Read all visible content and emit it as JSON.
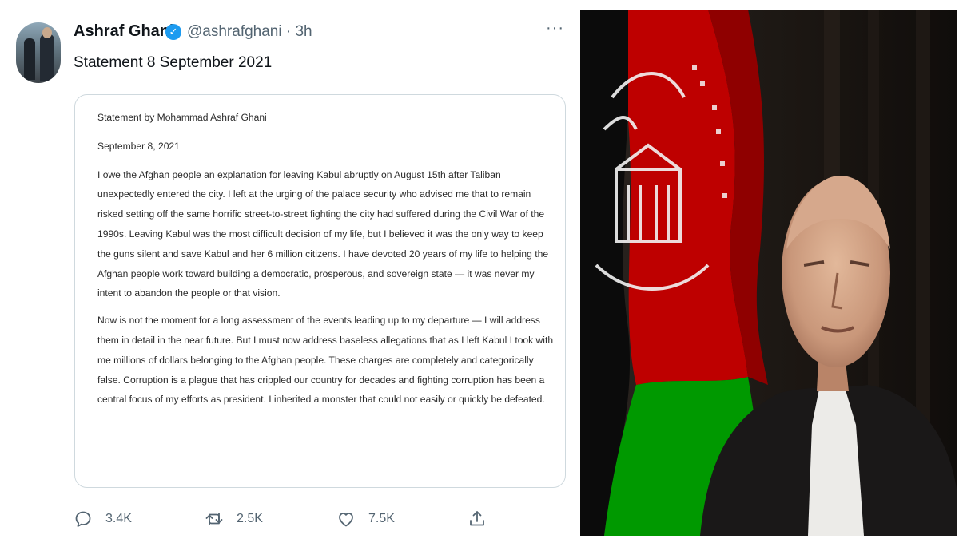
{
  "tweet": {
    "author_name": "Ashraf Ghani",
    "handle_time": "@ashrafghani · 3h",
    "more": "···",
    "text": "Statement 8 September 2021",
    "document": {
      "title": "Statement by Mohammad Ashraf Ghani",
      "date": "September 8, 2021",
      "paragraph_1": "I owe the Afghan people an explanation for leaving Kabul abruptly on August 15th after Taliban unexpectedly entered the city.  I left at the urging of the palace security who advised me that to remain risked setting off the same horrific street-to-street fighting the city had suffered during the Civil War of the 1990s.  Leaving Kabul was the most difficult decision of my life, but I believed it was the only way to keep the guns silent and save Kabul and her 6 million citizens.  I have devoted 20 years of my life to helping the Afghan people work toward building a democratic, prosperous, and sovereign state — it was never my intent to abandon the people or that vision.",
      "paragraph_2": "Now is not the moment for a long assessment of the events leading up to my departure — I will address them in detail in the near future.  But I must now address baseless allegations that as I left Kabul I took with me millions of dollars belonging to the Afghan people.  These charges are completely and categorically false.  Corruption is a plague that has crippled our country for decades and fighting corruption has been a central focus of my efforts as president. I inherited a monster that could not easily or quickly be defeated."
    },
    "actions": {
      "replies": "3.4K",
      "retweets": "2.5K",
      "likes": "7.5K"
    },
    "icons": [
      "verified-badge-icon",
      "more-icon",
      "reply-icon",
      "retweet-icon",
      "like-icon",
      "share-icon"
    ]
  },
  "colors": {
    "verified": "#1d9bf0",
    "secondary_text": "#536471",
    "flag_black": "#000000",
    "flag_red": "#be0000",
    "flag_green": "#009900"
  }
}
